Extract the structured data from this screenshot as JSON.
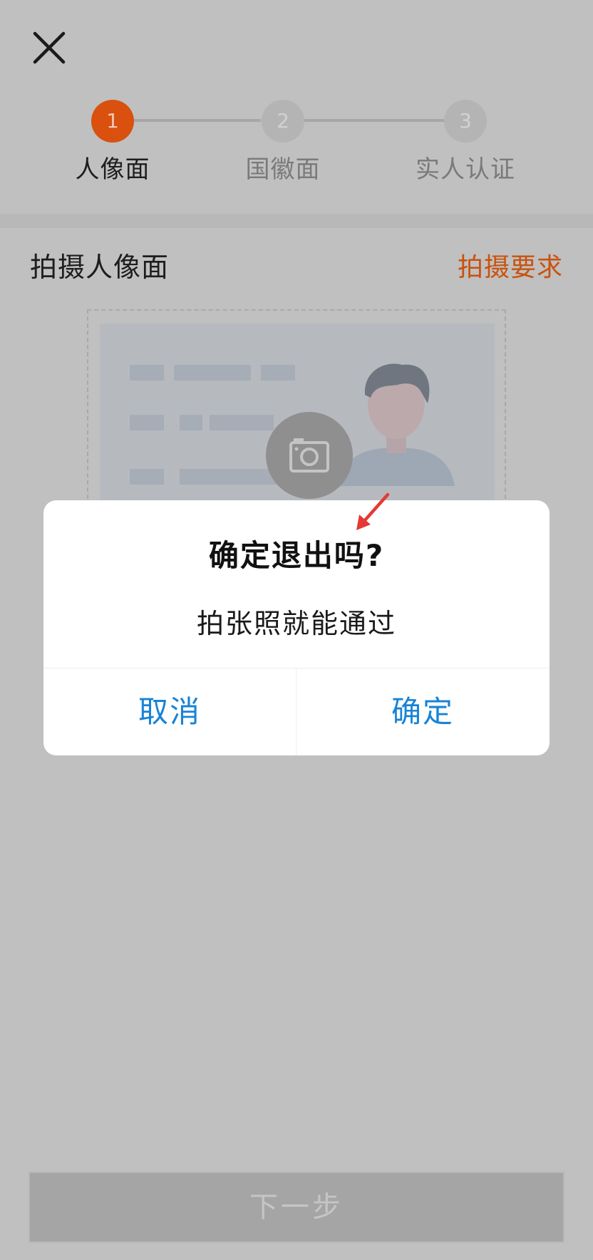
{
  "header": {
    "close_icon": "close-icon"
  },
  "steps": [
    {
      "number": "1",
      "label": "人像面",
      "active": true
    },
    {
      "number": "2",
      "label": "国徽面",
      "active": false
    },
    {
      "number": "3",
      "label": "实人认证",
      "active": false
    }
  ],
  "section": {
    "title": "拍摄人像面",
    "requirements_link": "拍摄要求"
  },
  "upload": {
    "camera_icon": "camera-icon",
    "placeholder_icon": "id-card-portrait-illustration"
  },
  "dialog": {
    "title": "确定退出吗?",
    "message": "拍张照就能通过",
    "cancel_label": "取消",
    "confirm_label": "确定"
  },
  "footer": {
    "next_label": "下一步"
  },
  "colors": {
    "accent": "#d9500f",
    "link": "#1883d6",
    "overlay": "#c0c0c0",
    "annotation_arrow": "#e53935"
  }
}
